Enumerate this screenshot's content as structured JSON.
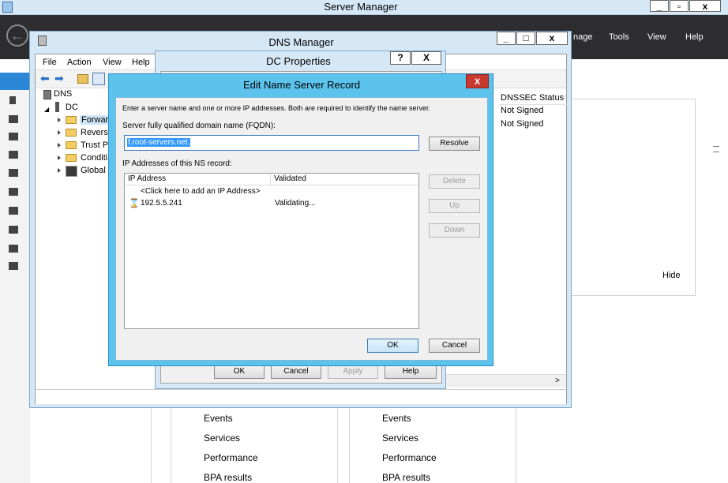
{
  "server_manager": {
    "title": "Server Manager",
    "menu": [
      "nage",
      "Tools",
      "View",
      "Help"
    ],
    "panel_hide": "Hide",
    "tiles": [
      {
        "items": [
          "Events",
          "Services",
          "Performance",
          "BPA results"
        ]
      },
      {
        "items": [
          "Events",
          "Services",
          "Performance",
          "BPA results"
        ]
      }
    ]
  },
  "dns_manager": {
    "title": "DNS Manager",
    "menu": [
      "File",
      "Action",
      "View",
      "Help"
    ],
    "tree": {
      "root": "DNS",
      "server": "DC",
      "children": [
        "Forward",
        "Reverse",
        "Trust Pc",
        "Conditi",
        "Global L"
      ]
    },
    "column_header": "DNSSEC Status",
    "rows": [
      "Not Signed",
      "Not Signed"
    ]
  },
  "dc_properties": {
    "title": "DC Properties",
    "help_btn": "?",
    "close_btn": "X",
    "buttons": {
      "ok": "OK",
      "cancel": "Cancel",
      "apply": "Apply",
      "help": "Help"
    }
  },
  "edit_ns": {
    "title": "Edit Name Server Record",
    "intro": "Enter a server name and one or more IP addresses.  Both are required to identify the name server.",
    "fqdn_label": "Server fully qualified domain name (FQDN):",
    "fqdn_value": "f.root-servers.net.",
    "resolve": "Resolve",
    "ip_label": "IP Addresses of this NS record:",
    "columns": [
      "IP Address",
      "Validated"
    ],
    "add_row": "<Click here to add an IP Address>",
    "entries": [
      {
        "ip": "192.5.5.241",
        "status": "Validating..."
      }
    ],
    "side_buttons": {
      "delete": "Delete",
      "up": "Up",
      "down": "Down"
    },
    "ok": "OK",
    "cancel": "Cancel",
    "close": "X"
  }
}
